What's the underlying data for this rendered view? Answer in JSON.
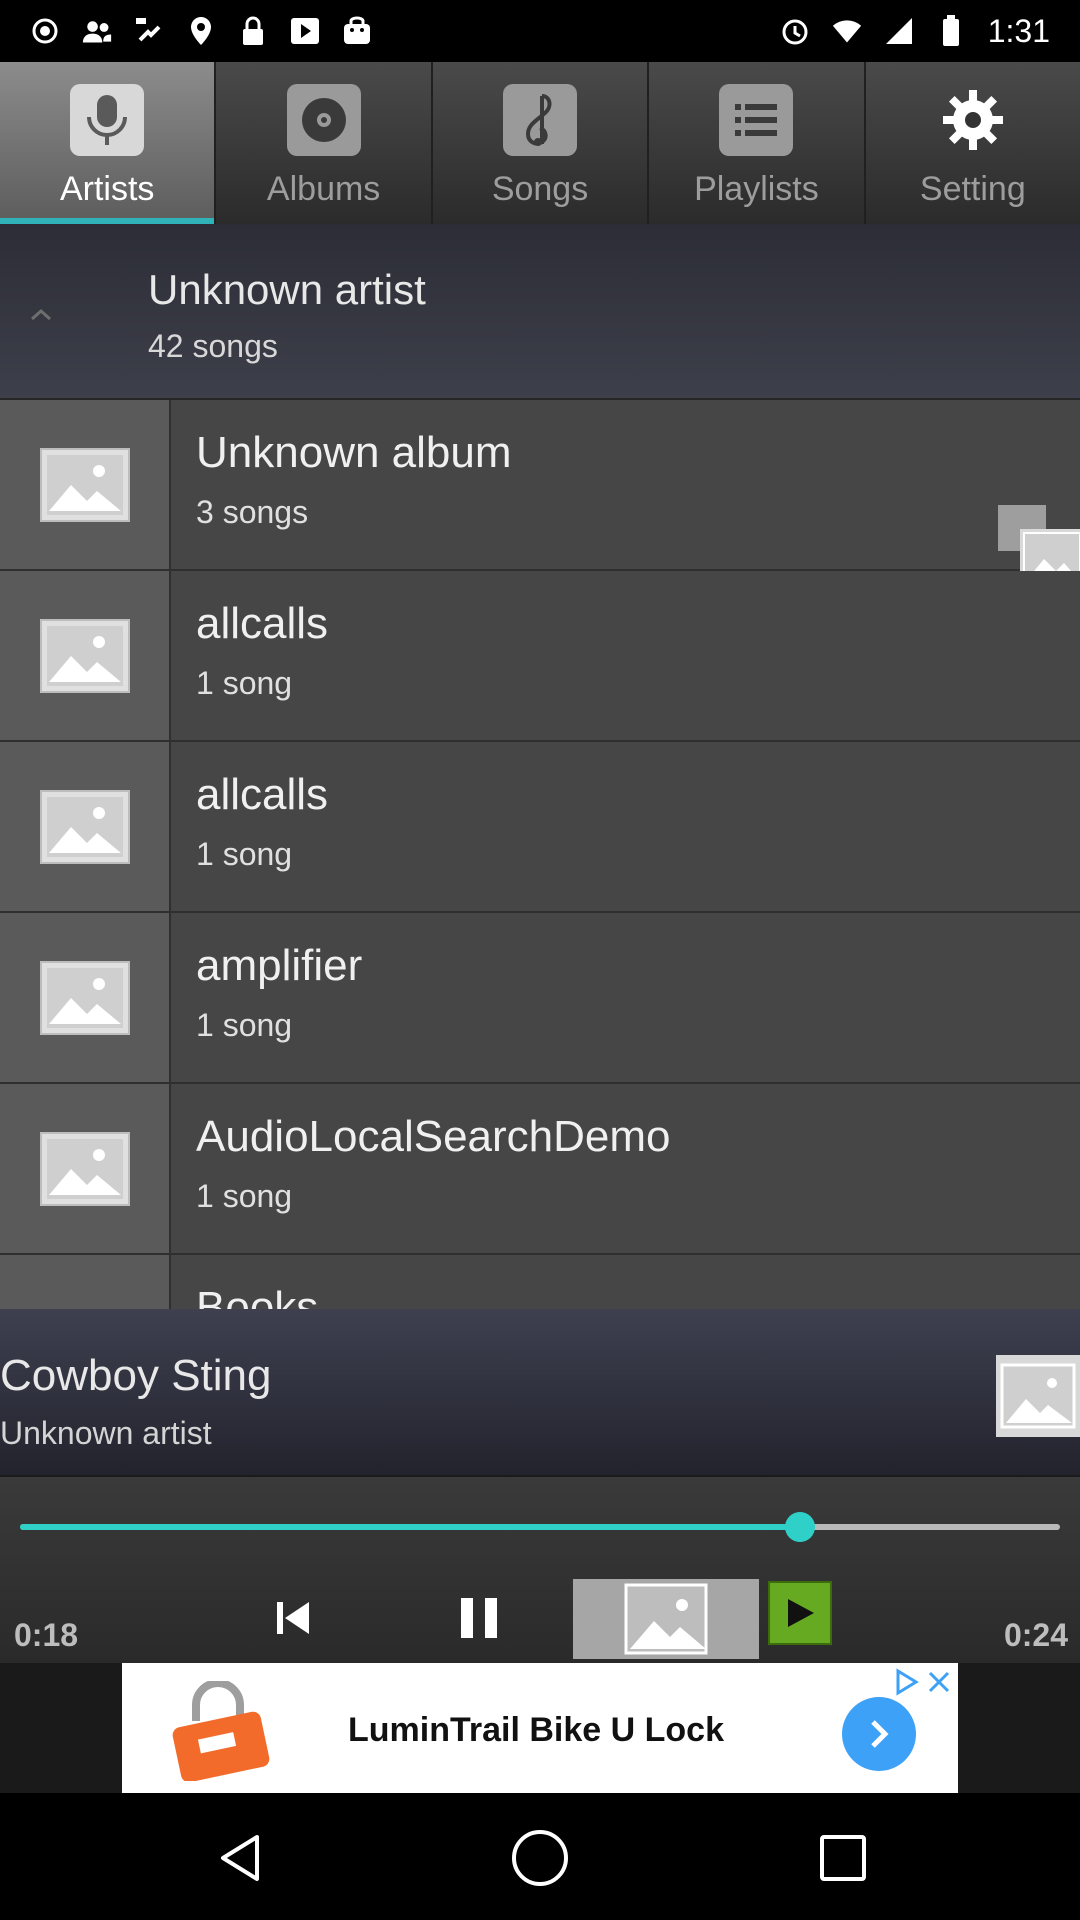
{
  "status_bar": {
    "time": "1:31",
    "left_icons": [
      "record-icon",
      "contacts-icon",
      "fake-gps-icon",
      "location-icon",
      "lock-icon",
      "play-store-icon",
      "bag-icon"
    ],
    "right_icons": [
      "alarm-icon",
      "wifi-icon",
      "signal-icon",
      "battery-icon"
    ]
  },
  "tabs": [
    {
      "label": "Artists",
      "icon": "microphone-icon",
      "active": true
    },
    {
      "label": "Albums",
      "icon": "disc-icon",
      "active": false
    },
    {
      "label": "Songs",
      "icon": "music-note-icon",
      "active": false
    },
    {
      "label": "Playlists",
      "icon": "list-icon",
      "active": false
    },
    {
      "label": "Setting",
      "icon": "gear-icon",
      "active": false
    }
  ],
  "artist_header": {
    "name": "Unknown artist",
    "count": "42 songs"
  },
  "albums": [
    {
      "title": "Unknown album",
      "count": "3 songs"
    },
    {
      "title": "allcalls",
      "count": "1 song"
    },
    {
      "title": "allcalls",
      "count": "1 song"
    },
    {
      "title": "amplifier",
      "count": "1 song"
    },
    {
      "title": "AudioLocalSearchDemo",
      "count": "1 song"
    },
    {
      "title": "Books",
      "count": ""
    }
  ],
  "now_playing": {
    "title": "Cowboy Sting",
    "artist": "Unknown artist"
  },
  "player": {
    "elapsed": "0:18",
    "total": "0:24",
    "progress": 0.75
  },
  "ad": {
    "text": "LuminTrail Bike U Lock"
  },
  "colors": {
    "accent": "#2fd0c8",
    "ad_button": "#3ca1f7",
    "play_green": "#66aa22"
  }
}
